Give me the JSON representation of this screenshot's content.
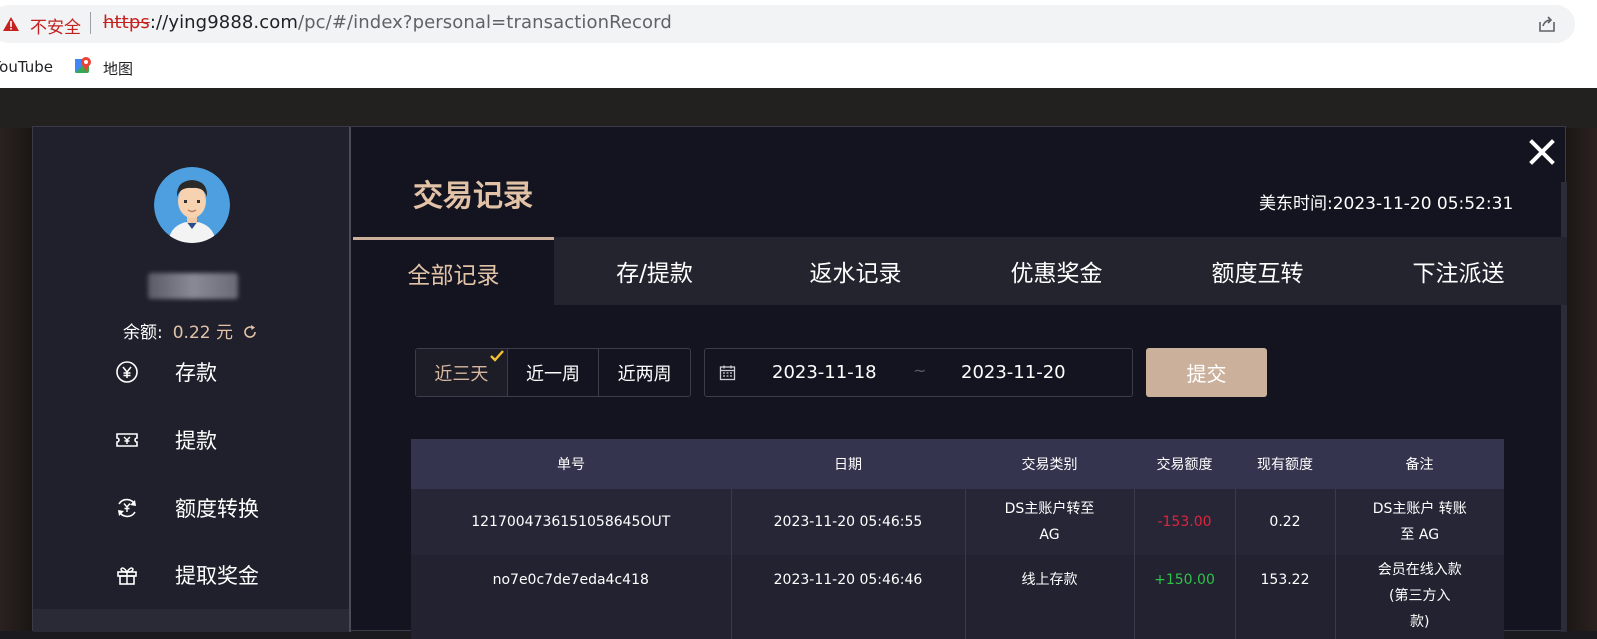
{
  "browser": {
    "security_label": "不安全",
    "url_scheme": "https",
    "url_host": "://ying9888.com",
    "url_path": "/pc/#/index?personal=transactionRecord",
    "bookmarks": [
      {
        "label": "YouTube"
      },
      {
        "label": "地图"
      }
    ]
  },
  "sidebar": {
    "balance_label": "余额:",
    "balance_value": "0.22 元",
    "items": [
      {
        "label": "存款",
        "icon": "yen-coin-icon"
      },
      {
        "label": "提款",
        "icon": "ticket-icon"
      },
      {
        "label": "额度转换",
        "icon": "exchange-icon"
      },
      {
        "label": "提取奖金",
        "icon": "gift-icon"
      }
    ]
  },
  "main": {
    "title": "交易记录",
    "clock": "美东时间:2023-11-20 05:52:31",
    "tabs": [
      {
        "label": "全部记录",
        "active": true
      },
      {
        "label": "存/提款"
      },
      {
        "label": "返水记录"
      },
      {
        "label": "优惠奖金"
      },
      {
        "label": "额度互转"
      },
      {
        "label": "下注派送"
      }
    ],
    "quick_ranges": [
      {
        "label": "近三天",
        "active": true
      },
      {
        "label": "近一周"
      },
      {
        "label": "近两周"
      }
    ],
    "date_from": "2023-11-18",
    "date_sep": "~",
    "date_to": "2023-11-20",
    "submit_label": "提交"
  },
  "table": {
    "headers": [
      "单号",
      "日期",
      "交易类别",
      "交易额度",
      "现有额度",
      "备注"
    ],
    "rows": [
      {
        "id": "1217004736151058645OUT",
        "date": "2023-11-20 05:46:55",
        "type_line1": "DS主账户转至",
        "type_line2": "AG",
        "amount": "-153.00",
        "balance": "0.22",
        "note_line1": "DS主账户 转账",
        "note_line2": "至 AG"
      },
      {
        "id": "no7e0c7de7eda4c418",
        "date": "2023-11-20 05:46:46",
        "type_line1": "线上存款",
        "amount": "+150.00",
        "balance": "153.22",
        "note_line1": "会员在线入款",
        "note_line2": "(第三方入",
        "note_line3": "款)"
      }
    ]
  },
  "colors": {
    "accent": "#e2c3a8",
    "button": "#cbb19c",
    "negative": "#e0243c",
    "positive": "#2fc24a"
  }
}
